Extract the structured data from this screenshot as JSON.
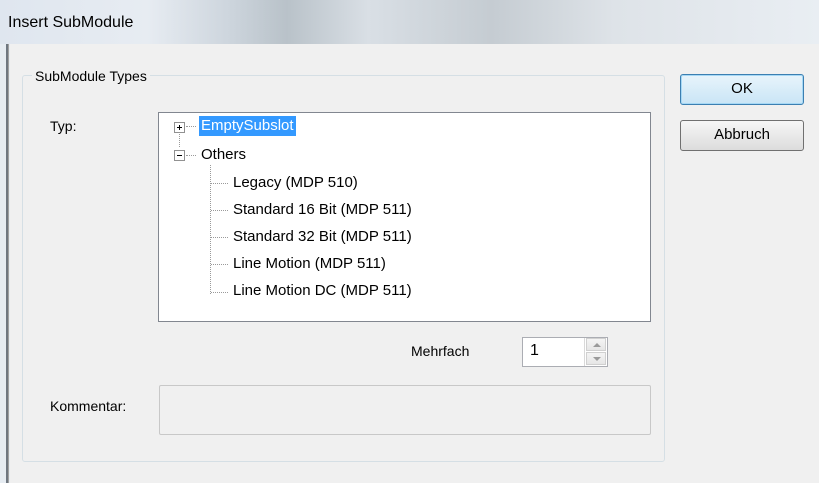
{
  "window": {
    "title": "Insert SubModule"
  },
  "group": {
    "label": "SubModule Types"
  },
  "labels": {
    "typ": "Typ:",
    "mehrfach": "Mehrfach",
    "kommentar": "Kommentar:"
  },
  "tree": {
    "root1": {
      "label": "EmptySubslot",
      "expanded": false,
      "selected": true
    },
    "root2": {
      "label": "Others",
      "expanded": true,
      "children": [
        "Legacy (MDP 510)",
        "Standard 16 Bit (MDP 511)",
        "Standard 32 Bit (MDP 511)",
        "Line Motion (MDP 511)",
        "Line Motion DC (MDP 511)"
      ]
    }
  },
  "mehrfach": {
    "value": "1"
  },
  "comment": {
    "value": ""
  },
  "buttons": {
    "ok": "OK",
    "cancel": "Abbruch"
  },
  "colors": {
    "selection": "#3399ff",
    "dialog_bg": "#f0f0f0",
    "default_button_border": "#3c7fb1"
  }
}
